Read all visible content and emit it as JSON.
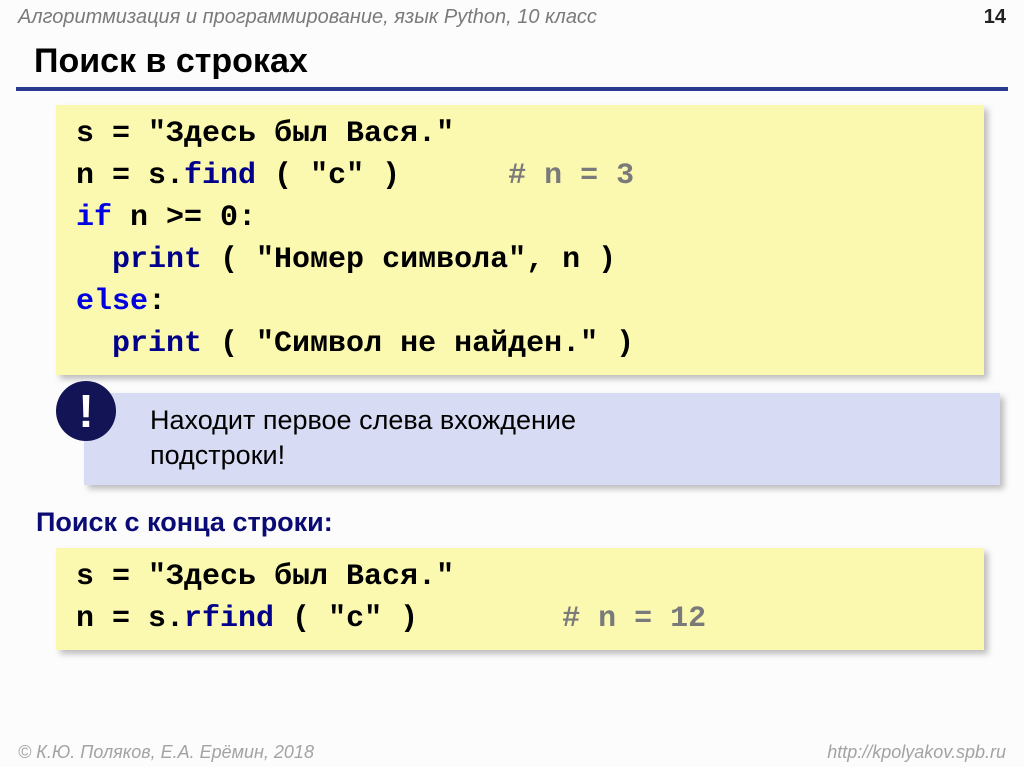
{
  "header": {
    "course": "Алгоритмизация и программирование, язык Python, 10 класс",
    "page": "14"
  },
  "title": "Поиск в строках",
  "code1": {
    "l1_a": "s = ",
    "l1_b": "\"Здесь был Вася.\"",
    "l2_a": "n = s.",
    "l2_fn": "find",
    "l2_b": " ( ",
    "l2_c": "\"с\"",
    "l2_d": " )      ",
    "l2_cm": "# n = 3",
    "l3_if": "if",
    "l3_a": " n >= ",
    "l3_b": "0",
    "l3_c": ":",
    "l4_a": "  ",
    "l4_fn": "print",
    "l4_b": " ( ",
    "l4_c": "\"Номер символа\"",
    "l4_d": ", n )",
    "l5_else": "else",
    "l5_a": ":",
    "l6_a": "  ",
    "l6_fn": "print",
    "l6_b": " ( ",
    "l6_c": "\"Символ не найден.\"",
    "l6_d": " )"
  },
  "note": {
    "excl": "!",
    "text1": "Находит первое слева вхождение",
    "text2": "подстроки!"
  },
  "subtitle": "Поиск с конца строки:",
  "code2": {
    "l1_a": "s = ",
    "l1_b": "\"Здесь был Вася.\"",
    "l2_a": "n = s.",
    "l2_fn": "rfind",
    "l2_b": " ( ",
    "l2_c": "\"с\"",
    "l2_d": " )        ",
    "l2_cm": "# n = 12"
  },
  "footer": {
    "left": "© К.Ю. Поляков, Е.А. Ерёмин, 2018",
    "right": "http://kpolyakov.spb.ru"
  }
}
